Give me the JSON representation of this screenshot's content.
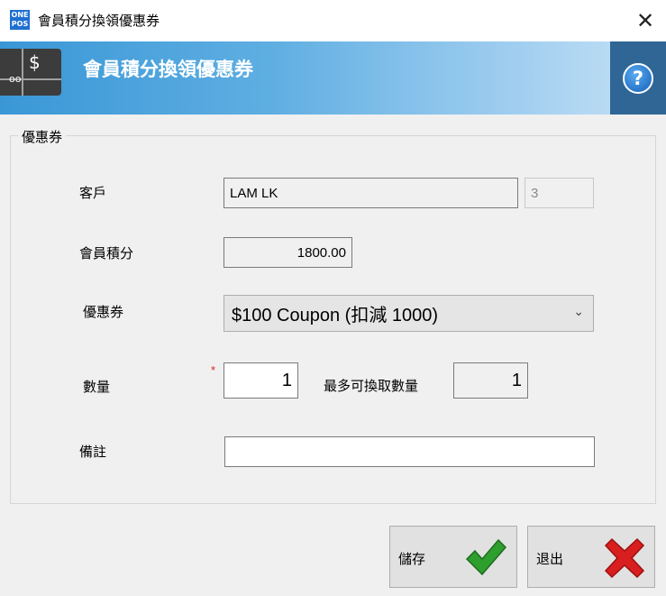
{
  "window": {
    "logo_line1": "ONE",
    "logo_line2": "POS",
    "title": "會員積分換領優惠券",
    "close_symbol": "✕"
  },
  "banner": {
    "title": "會員積分換領優惠券",
    "icon_symbol": "$",
    "help_symbol": "?"
  },
  "group": {
    "legend": "優惠券"
  },
  "form": {
    "customer_label": "客戶",
    "customer_name": "LAM LK",
    "customer_id": "3",
    "points_label": "會員積分",
    "points_value": "1800.00",
    "coupon_label": "優惠券",
    "coupon_selected": "$100 Coupon (扣減 1000)",
    "quantity_label": "數量",
    "required_marker": "*",
    "quantity_value": "1",
    "max_quantity_label": "最多可換取數量",
    "max_quantity_value": "1",
    "remarks_label": "備註",
    "remarks_value": ""
  },
  "buttons": {
    "save_label": "儲存",
    "exit_label": "退出"
  },
  "colors": {
    "banner_start": "#3a97d6",
    "banner_end": "#c8e2f6",
    "help_bg": "#2f6696",
    "save_check": "#2e9e2e",
    "exit_cross": "#d81e1e",
    "required": "#e02020"
  }
}
